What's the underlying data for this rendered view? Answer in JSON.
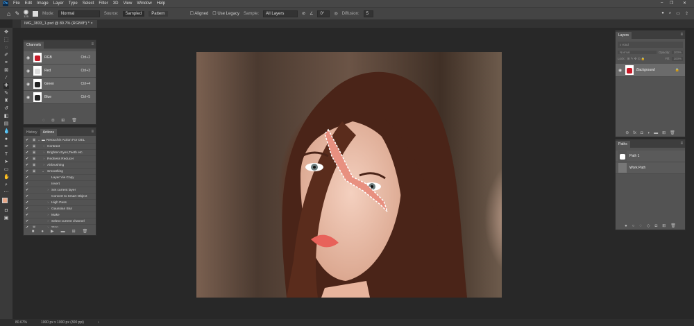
{
  "app": {
    "logo": "Ps",
    "menu": [
      "File",
      "Edit",
      "Image",
      "Layer",
      "Type",
      "Select",
      "Filter",
      "3D",
      "View",
      "Window",
      "Help"
    ]
  },
  "options": {
    "brush_size": "125",
    "mode_label": "Mode:",
    "mode_value": "Normal",
    "source_label": "Source:",
    "sampled": "Sampled",
    "pattern": "Pattern",
    "aligned": "Aligned",
    "use_legacy": "Use Legacy",
    "sample_label": "Sample:",
    "sample_value": "All Layers",
    "angle": "0°",
    "diffusion_label": "Diffusion:",
    "diffusion_value": "5"
  },
  "document": {
    "tab_title": "IMG_3833_1.psd @ 80.7% (RGB/8*) *",
    "zoom": "80.67%",
    "dimensions": "1000 px x 1000 px (300 ppi)"
  },
  "channels": {
    "title": "Channels",
    "rows": [
      {
        "name": "RGB",
        "shortcut": "Ctrl+2",
        "color": "#c81a28"
      },
      {
        "name": "Red",
        "shortcut": "Ctrl+3",
        "color": "#dddddd"
      },
      {
        "name": "Green",
        "shortcut": "Ctrl+4",
        "color": "#222222"
      },
      {
        "name": "Blue",
        "shortcut": "Ctrl+5",
        "color": "#222222"
      }
    ]
  },
  "actions": {
    "tabs": [
      "History",
      "Actions"
    ],
    "items": [
      "Retouchin Action For OEL",
      "Contrast",
      "Brighten Eyes,Teeth etc.",
      "Redness Reducer",
      "Airbrushing",
      "Smoothing",
      "Layer Via Copy",
      "Invert",
      "Set current layer",
      "Convert to Smart Object",
      "High Pass",
      "Gaussian Blur",
      "Make",
      "Select current channel",
      "Stop"
    ]
  },
  "layers": {
    "title": "Layers",
    "kind": "Kind",
    "blend": "Normal",
    "opacity_label": "Opacity:",
    "opacity": "100%",
    "lock_label": "Lock:",
    "fill_label": "Fill:",
    "fill": "100%",
    "layer_name": "Background"
  },
  "paths": {
    "title": "Paths",
    "rows": [
      "Path 1",
      "Work Path"
    ]
  }
}
